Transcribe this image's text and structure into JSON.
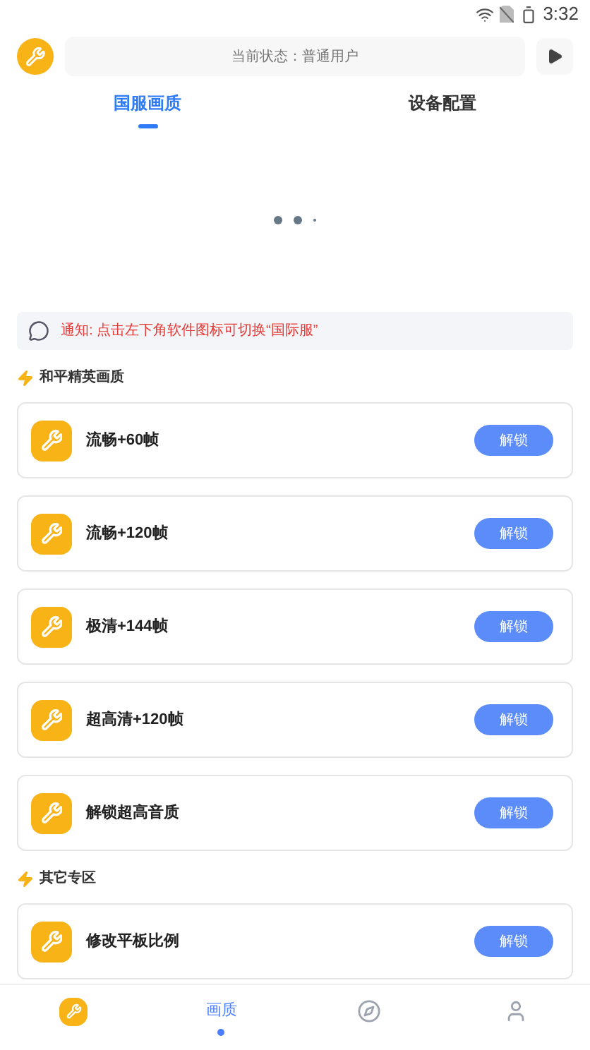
{
  "status_bar": {
    "time": "3:32"
  },
  "header": {
    "status_text": "当前状态：普通用户"
  },
  "tabs": [
    {
      "label": "国服画质",
      "selected": true
    },
    {
      "label": "设备配置",
      "selected": false
    }
  ],
  "notice": {
    "text": "通知: 点击左下角软件图标可切换“国际服”"
  },
  "sections": [
    {
      "title": "和平精英画质",
      "items": [
        {
          "label": "流畅+60帧",
          "button": "解锁"
        },
        {
          "label": "流畅+120帧",
          "button": "解锁"
        },
        {
          "label": "极清+144帧",
          "button": "解锁"
        },
        {
          "label": "超高清+120帧",
          "button": "解锁"
        },
        {
          "label": "解锁超高音质",
          "button": "解锁"
        }
      ]
    },
    {
      "title": "其它专区",
      "items": [
        {
          "label": "修改平板比例",
          "button": "解锁"
        }
      ]
    }
  ],
  "bottom_nav": [
    {
      "kind": "app",
      "selected": false
    },
    {
      "kind": "text",
      "label": "画质",
      "selected": true
    },
    {
      "kind": "compass",
      "selected": false
    },
    {
      "kind": "user",
      "selected": false
    }
  ]
}
